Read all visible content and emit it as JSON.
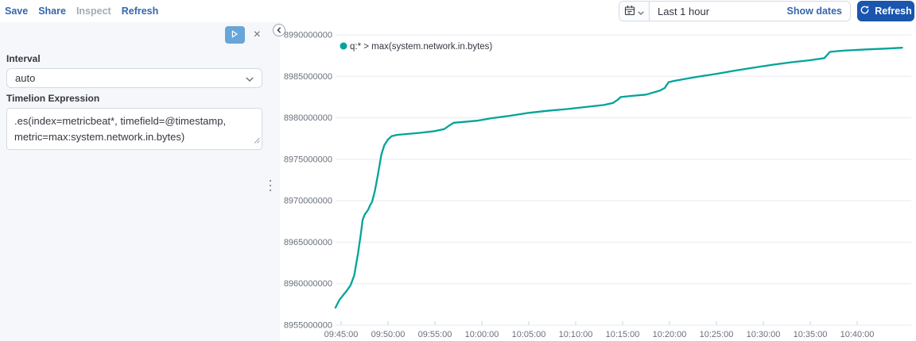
{
  "colors": {
    "link": "#3566ad",
    "button_fill": "#1a55b0",
    "series": "#00a49b",
    "grid": "#e6e9ed",
    "tick": "#cfd3d9",
    "axis_text": "#69707d"
  },
  "top_nav": {
    "items": [
      {
        "label": "Save",
        "disabled": false
      },
      {
        "label": "Share",
        "disabled": false
      },
      {
        "label": "Inspect",
        "disabled": true
      },
      {
        "label": "Refresh",
        "disabled": false
      }
    ]
  },
  "datepicker": {
    "duration": "Last 1 hour",
    "show_dates_label": "Show dates",
    "refresh_label": "Refresh"
  },
  "editor": {
    "interval_label": "Interval",
    "interval_value": "auto",
    "expression_label": "Timelion Expression",
    "expression_value": ".es(index=metricbeat*, timefield=@timestamp, metric=max:system.network.in.bytes)",
    "close_glyph": "×"
  },
  "chart_data": {
    "type": "line",
    "title": "",
    "xlabel": "",
    "ylabel": "",
    "grid": true,
    "legend": {
      "position": "top-left",
      "label": "q:* > max(system.network.in.bytes)",
      "color": "#00a49b"
    },
    "y_range": [
      8955000000,
      8990000000
    ],
    "y_ticks": [
      {
        "value": 8955000000,
        "label": "8955000000"
      },
      {
        "value": 8960000000,
        "label": "8960000000"
      },
      {
        "value": 8965000000,
        "label": "8965000000"
      },
      {
        "value": 8970000000,
        "label": "8970000000"
      },
      {
        "value": 8975000000,
        "label": "8975000000"
      },
      {
        "value": 8980000000,
        "label": "8980000000"
      },
      {
        "value": 8985000000,
        "label": "8985000000"
      },
      {
        "value": 8990000000,
        "label": "8990000000"
      }
    ],
    "x_range_minutes": [
      -0.6,
      60.8
    ],
    "x_ticks": [
      {
        "minutes": 0,
        "label": "09:45:00"
      },
      {
        "minutes": 5,
        "label": "09:50:00"
      },
      {
        "minutes": 10,
        "label": "09:55:00"
      },
      {
        "minutes": 15,
        "label": "10:00:00"
      },
      {
        "minutes": 20,
        "label": "10:05:00"
      },
      {
        "minutes": 25,
        "label": "10:10:00"
      },
      {
        "minutes": 30,
        "label": "10:15:00"
      },
      {
        "minutes": 35,
        "label": "10:20:00"
      },
      {
        "minutes": 40,
        "label": "10:25:00"
      },
      {
        "minutes": 45,
        "label": "10:30:00"
      },
      {
        "minutes": 50,
        "label": "10:35:00"
      },
      {
        "minutes": 55,
        "label": "10:40:00"
      }
    ],
    "series": [
      {
        "name": "q:* > max(system.network.in.bytes)",
        "color": "#00a49b",
        "points": [
          [
            -0.6,
            8957100000
          ],
          [
            -0.2,
            8958000000
          ],
          [
            0.2,
            8958600000
          ],
          [
            0.6,
            8959150000
          ],
          [
            1.0,
            8959800000
          ],
          [
            1.4,
            8961000000
          ],
          [
            1.8,
            8963600000
          ],
          [
            2.1,
            8966000000
          ],
          [
            2.3,
            8967700000
          ],
          [
            2.5,
            8968300000
          ],
          [
            2.9,
            8968950000
          ],
          [
            3.1,
            8969500000
          ],
          [
            3.3,
            8969850000
          ],
          [
            3.6,
            8971200000
          ],
          [
            3.9,
            8973000000
          ],
          [
            4.3,
            8975600000
          ],
          [
            4.6,
            8976700000
          ],
          [
            5.0,
            8977400000
          ],
          [
            5.4,
            8977800000
          ],
          [
            6.0,
            8977950000
          ],
          [
            7.0,
            8978050000
          ],
          [
            8.5,
            8978200000
          ],
          [
            10.0,
            8978400000
          ],
          [
            11.0,
            8978650000
          ],
          [
            11.5,
            8979050000
          ],
          [
            12.0,
            8979400000
          ],
          [
            13.0,
            8979500000
          ],
          [
            14.5,
            8979650000
          ],
          [
            16.0,
            8979950000
          ],
          [
            18.0,
            8980250000
          ],
          [
            20.0,
            8980600000
          ],
          [
            22.0,
            8980850000
          ],
          [
            24.0,
            8981050000
          ],
          [
            26.0,
            8981300000
          ],
          [
            28.0,
            8981550000
          ],
          [
            29.0,
            8981800000
          ],
          [
            29.5,
            8982200000
          ],
          [
            29.8,
            8982500000
          ],
          [
            31.0,
            8982650000
          ],
          [
            32.5,
            8982800000
          ],
          [
            34.0,
            8983300000
          ],
          [
            34.5,
            8983600000
          ],
          [
            34.9,
            8984300000
          ],
          [
            35.5,
            8984450000
          ],
          [
            36.5,
            8984650000
          ],
          [
            38.0,
            8984950000
          ],
          [
            40.0,
            8985300000
          ],
          [
            42.0,
            8985700000
          ],
          [
            44.0,
            8986050000
          ],
          [
            46.0,
            8986400000
          ],
          [
            48.0,
            8986700000
          ],
          [
            50.0,
            8986950000
          ],
          [
            51.5,
            8987200000
          ],
          [
            52.1,
            8987950000
          ],
          [
            53.5,
            8988100000
          ],
          [
            56.0,
            8988250000
          ],
          [
            58.0,
            8988350000
          ],
          [
            59.8,
            8988450000
          ]
        ]
      }
    ]
  }
}
